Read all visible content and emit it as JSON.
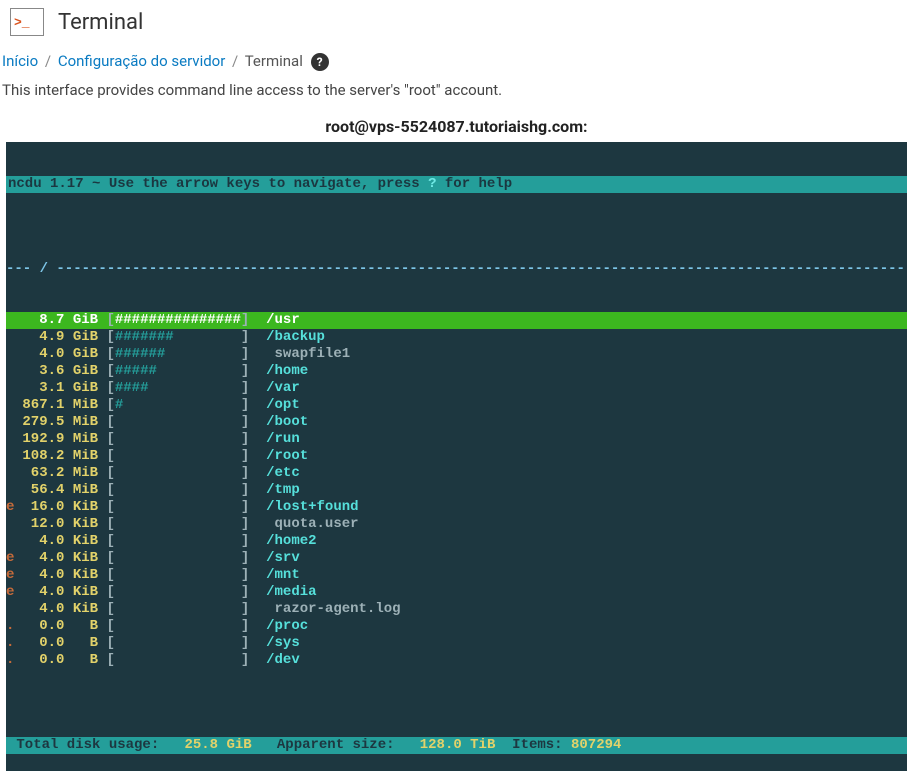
{
  "header": {
    "title": "Terminal"
  },
  "breadcrumb": {
    "items": [
      {
        "label": "Início",
        "link": true
      },
      {
        "label": "Configuração do servidor",
        "link": true
      },
      {
        "label": "Terminal",
        "link": false
      }
    ]
  },
  "description": "This interface provides command line access to the server's \"root\" account.",
  "terminal_title": "root@vps-5524087.tutoriaishg.com:",
  "ncdu": {
    "topbar_left": "ncdu 1.17 ~ Use the arrow keys to navigate, press ",
    "topbar_help_key": "?",
    "topbar_right": " for help",
    "path_line": "--- / ---------------------------------------------------------------------------------------------------------------",
    "rows": [
      {
        "mark": "",
        "size": "8.7",
        "unit": "GiB",
        "bar": "###############",
        "name": "/usr",
        "is_dir": true,
        "selected": true
      },
      {
        "mark": "",
        "size": "4.9",
        "unit": "GiB",
        "bar": "#######        ",
        "name": "/backup",
        "is_dir": true
      },
      {
        "mark": "",
        "size": "4.0",
        "unit": "GiB",
        "bar": "######         ",
        "name": "swapfile1",
        "is_dir": false
      },
      {
        "mark": "",
        "size": "3.6",
        "unit": "GiB",
        "bar": "#####          ",
        "name": "/home",
        "is_dir": true
      },
      {
        "mark": "",
        "size": "3.1",
        "unit": "GiB",
        "bar": "####           ",
        "name": "/var",
        "is_dir": true
      },
      {
        "mark": "",
        "size": "867.1",
        "unit": "MiB",
        "bar": "#              ",
        "name": "/opt",
        "is_dir": true
      },
      {
        "mark": "",
        "size": "279.5",
        "unit": "MiB",
        "bar": "               ",
        "name": "/boot",
        "is_dir": true
      },
      {
        "mark": "",
        "size": "192.9",
        "unit": "MiB",
        "bar": "               ",
        "name": "/run",
        "is_dir": true
      },
      {
        "mark": "",
        "size": "108.2",
        "unit": "MiB",
        "bar": "               ",
        "name": "/root",
        "is_dir": true
      },
      {
        "mark": "",
        "size": "63.2",
        "unit": "MiB",
        "bar": "               ",
        "name": "/etc",
        "is_dir": true
      },
      {
        "mark": "",
        "size": "56.4",
        "unit": "MiB",
        "bar": "               ",
        "name": "/tmp",
        "is_dir": true
      },
      {
        "mark": "e",
        "size": "16.0",
        "unit": "KiB",
        "bar": "               ",
        "name": "/lost+found",
        "is_dir": true
      },
      {
        "mark": "",
        "size": "12.0",
        "unit": "KiB",
        "bar": "               ",
        "name": "quota.user",
        "is_dir": false
      },
      {
        "mark": "",
        "size": "4.0",
        "unit": "KiB",
        "bar": "               ",
        "name": "/home2",
        "is_dir": true
      },
      {
        "mark": "e",
        "size": "4.0",
        "unit": "KiB",
        "bar": "               ",
        "name": "/srv",
        "is_dir": true
      },
      {
        "mark": "e",
        "size": "4.0",
        "unit": "KiB",
        "bar": "               ",
        "name": "/mnt",
        "is_dir": true
      },
      {
        "mark": "e",
        "size": "4.0",
        "unit": "KiB",
        "bar": "               ",
        "name": "/media",
        "is_dir": true
      },
      {
        "mark": "",
        "size": "4.0",
        "unit": "KiB",
        "bar": "               ",
        "name": "razor-agent.log",
        "is_dir": false
      },
      {
        "mark": ".",
        "size": "0.0",
        "unit": "B",
        "bar": "               ",
        "name": "/proc",
        "is_dir": true
      },
      {
        "mark": ".",
        "size": "0.0",
        "unit": "B",
        "bar": "               ",
        "name": "/sys",
        "is_dir": true
      },
      {
        "mark": ".",
        "size": "0.0",
        "unit": "B",
        "bar": "               ",
        "name": "/dev",
        "is_dir": true
      }
    ],
    "footer": {
      "label_total": " Total disk usage:",
      "total": "25.8 GiB",
      "label_apparent": "Apparent size:",
      "apparent": "128.0 TiB",
      "label_items": "Items:",
      "items": "807294"
    }
  }
}
